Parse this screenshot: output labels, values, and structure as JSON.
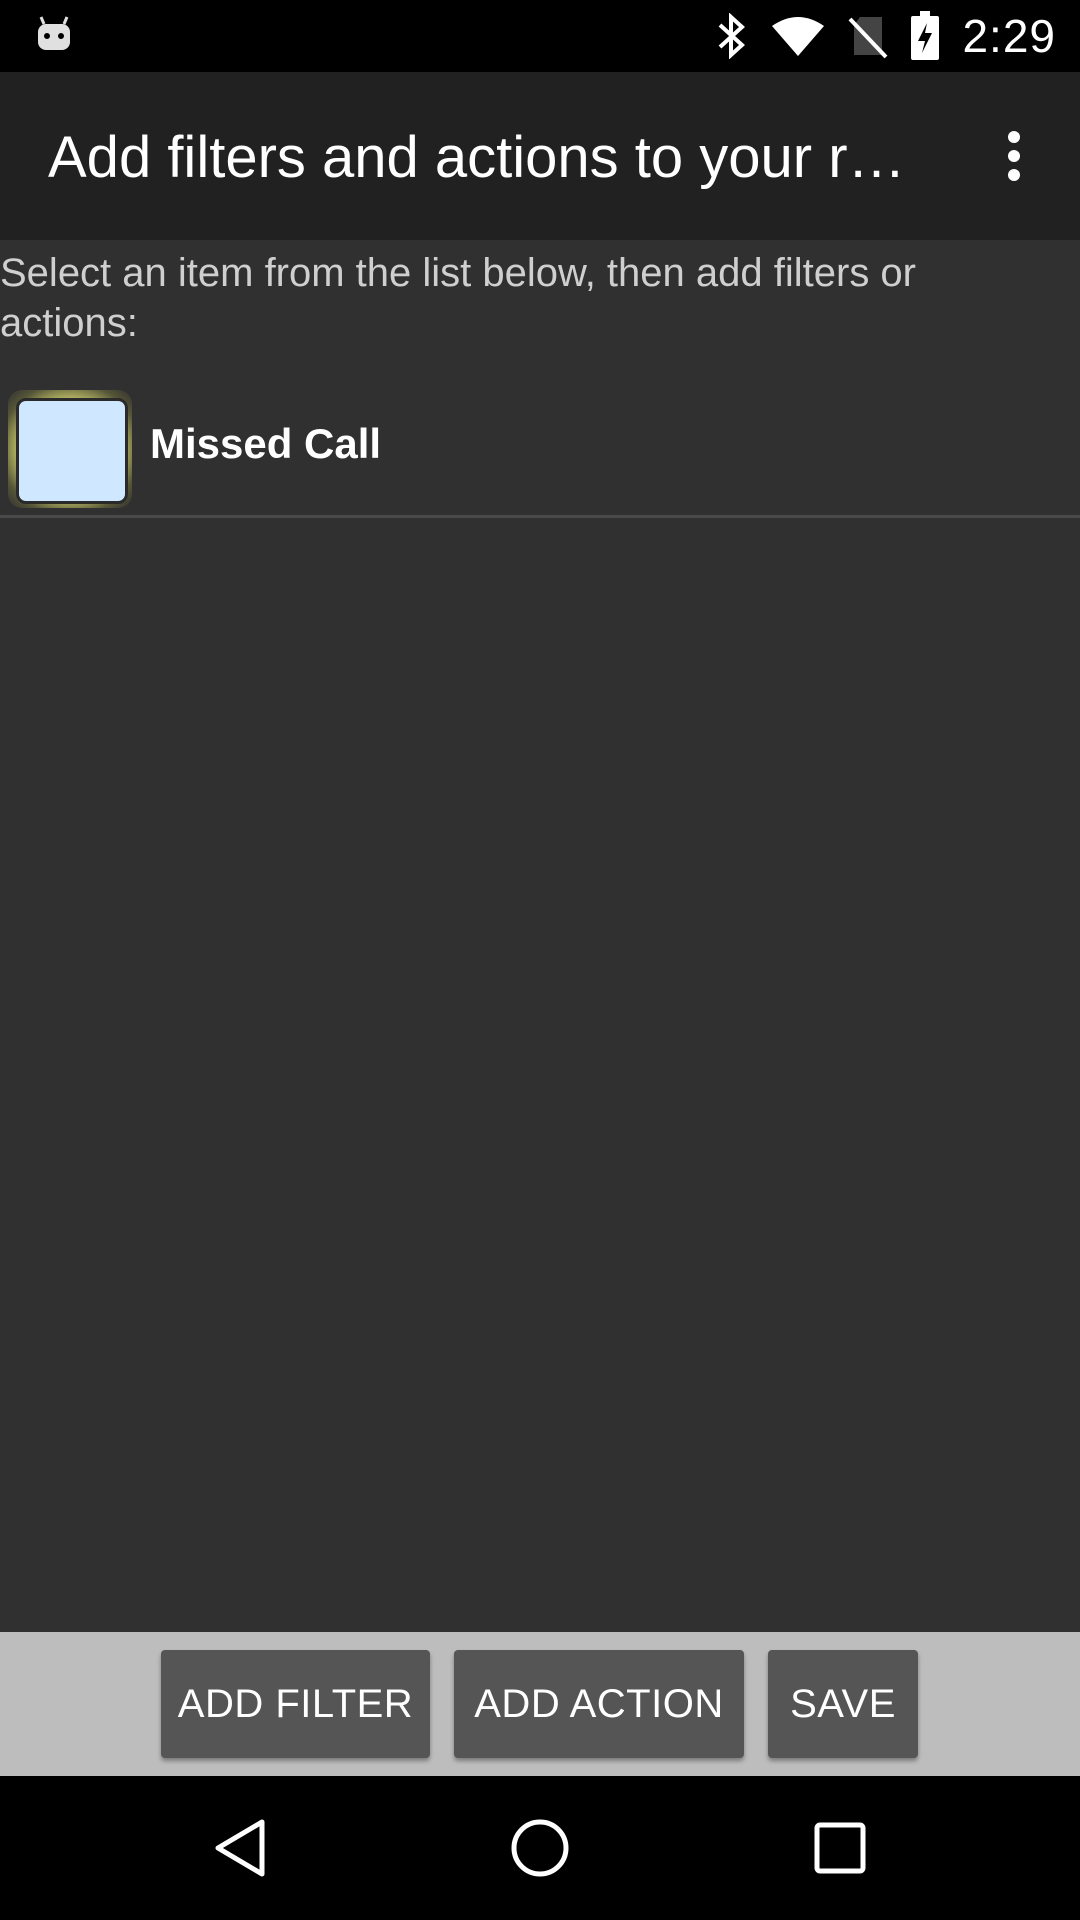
{
  "status_bar": {
    "time": "2:29",
    "icons": [
      "android-icon",
      "bluetooth-icon",
      "wifi-icon",
      "no-sim-icon",
      "battery-charging-icon"
    ]
  },
  "app_bar": {
    "title": "Add filters and actions to your r…",
    "overflow_icon": "more-vert-icon"
  },
  "content": {
    "instructions": "Select an item from the list below, then add filters or actions:",
    "items": [
      {
        "label": "Missed Call",
        "icon": "missed-call-icon"
      }
    ]
  },
  "buttons": {
    "add_filter": "ADD FILTER",
    "add_action": "ADD ACTION",
    "save": "SAVE"
  },
  "nav_bar": {
    "icons": [
      "back-icon",
      "home-icon",
      "recents-icon"
    ]
  },
  "colors": {
    "background": "#303030",
    "app_bar": "#212121",
    "button": "#555555",
    "button_bar": "#bdbdbd",
    "item_icon": "#cfe7ff"
  }
}
